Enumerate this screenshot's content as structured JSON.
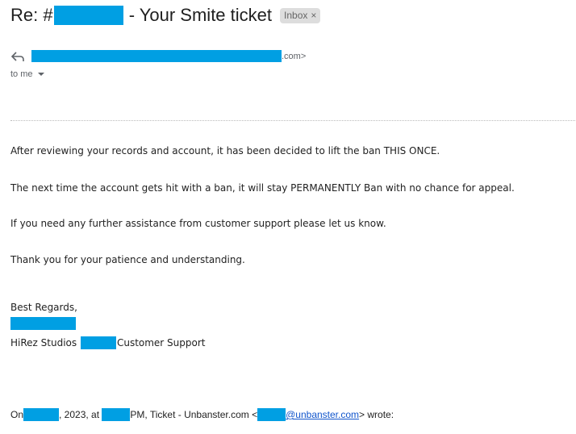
{
  "email": {
    "subject_prefix": "Re: #",
    "subject_suffix": " - Your Smite ticket",
    "label": "Inbox",
    "label_remove": "×",
    "sender_suffix": ".com>",
    "recipient": "to me",
    "body": [
      "After reviewing your records and account, it has been decided to lift the ban THIS ONCE.",
      "The next time the account gets hit with a ban, it will stay PERMANENTLY Ban with no chance for appeal.",
      "If you need any further assistance from customer support please let us know.",
      "Thank you for your patience and understanding."
    ],
    "signature": {
      "closing": "Best Regards,",
      "company_prefix": "HiRez Studios ",
      "company_suffix": "Customer Support"
    },
    "quote": {
      "on": "On",
      "year": ", 2023, at ",
      "pm": "PM, Ticket - Unbanster.com <",
      "email_domain": "@unbanster.com",
      "wrote": "> wrote:"
    }
  },
  "colors": {
    "redaction": "#009fe3"
  }
}
